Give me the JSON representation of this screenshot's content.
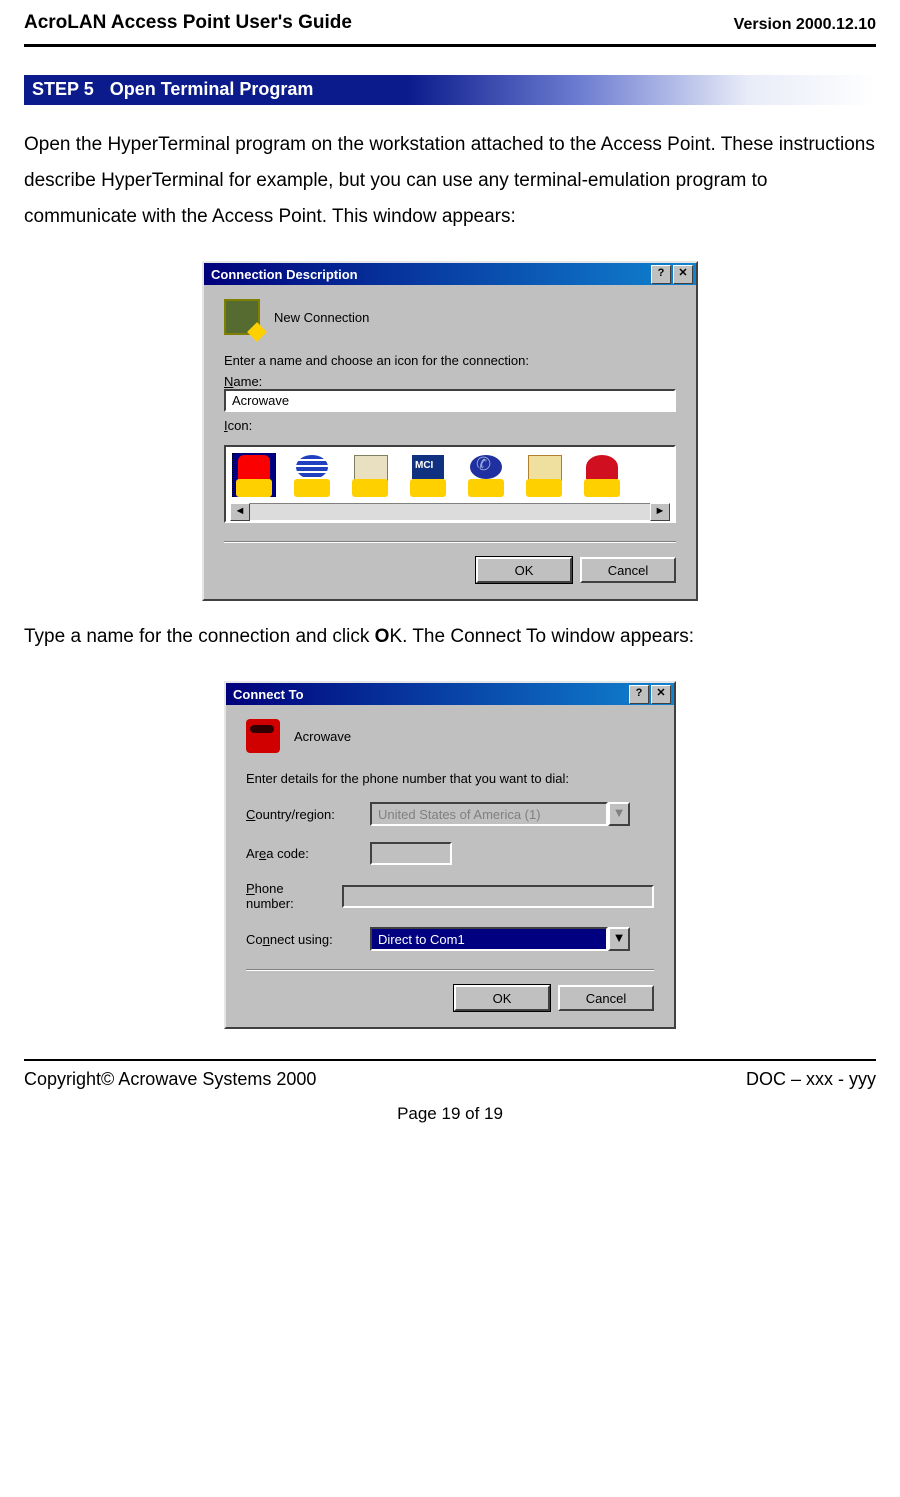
{
  "header": {
    "title": "AcroLAN Access Point User's Guide",
    "version": "Version 2000.12.10"
  },
  "step": {
    "number": "STEP 5",
    "title": "Open Terminal Program"
  },
  "paragraph1": "Open the HyperTerminal program on the workstation attached to the Access Point. These instructions describe HyperTerminal for example, but you can use any terminal-emulation program to communicate with the Access Point. This window appears:",
  "paragraph2_pre": "Type a name for the connection and click ",
  "paragraph2_bold": "O",
  "paragraph2_post": "K. The Connect To window appears:",
  "dialog1": {
    "title": "Connection Description",
    "help_btn": "?",
    "close_btn": "✕",
    "new_connection_label": "New Connection",
    "prompt": "Enter a name and choose an icon for the connection:",
    "name_label_u": "N",
    "name_label_rest": "ame:",
    "name_value": "Acrowave",
    "icon_label_u": "I",
    "icon_label_rest": "con:",
    "scroll_left": "◄",
    "scroll_right": "►",
    "ok": "OK",
    "cancel": "Cancel"
  },
  "dialog2": {
    "title": "Connect To",
    "help_btn": "?",
    "close_btn": "✕",
    "conn_name": "Acrowave",
    "prompt": "Enter details for the phone number that you want to dial:",
    "country_label_u": "C",
    "country_label_rest": "ountry/region:",
    "country_value": "United States of America (1)",
    "area_label_pre": "Ar",
    "area_label_u": "e",
    "area_label_post": "a code:",
    "area_value": "",
    "phone_label_u": "P",
    "phone_label_rest": "hone number:",
    "phone_value": "",
    "connect_label_pre": "Co",
    "connect_label_u": "n",
    "connect_label_post": "nect using:",
    "connect_value": "Direct to Com1",
    "dropdown_arrow": "▼",
    "ok": "OK",
    "cancel": "Cancel"
  },
  "footer": {
    "copyright": "Copyright© Acrowave Systems 2000",
    "doc": "DOC – xxx - yyy",
    "page": "Page 19 of 19"
  }
}
